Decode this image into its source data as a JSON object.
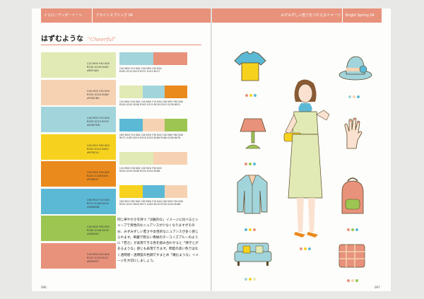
{
  "left_page": {
    "header_category": "イエローアンダートーン",
    "header_section": "ブライトスプリング 04",
    "title_jp": "はずむような",
    "title_en": "\"Cheerful\"",
    "swatches": [
      {
        "color": "#e1eab4",
        "cmyk": "C10 M00 Y40 K00",
        "rgb": "R240 G245 B180",
        "hex": "#EEF4A0"
      },
      {
        "color": "#f6d2b2",
        "cmyk": "C00 M20 Y30 K00",
        "rgb": "R250 G220 B186",
        "hex": "#F9DCBA"
      },
      {
        "color": "#a2d4dc",
        "cmyk": "C40 M00 Y15 K00",
        "rgb": "R163 G215 B219",
        "hex": "#A3D7DB"
      },
      {
        "color": "#f6d21e",
        "cmyk": "C00 M10 Y85 K00",
        "rgb": "R255 G222 B020",
        "hex": "#FFDE14"
      },
      {
        "color": "#ea8a1c",
        "cmyk": "C00 M55 Y90 K00",
        "rgb": "R243 G138 B031",
        "hex": "#F38A1F"
      },
      {
        "color": "#5cb9d5",
        "cmyk": "C65 M00 Y10 K00",
        "rgb": "R072 G185 B219",
        "hex": "#48B9DB"
      },
      {
        "color": "#9cc552",
        "cmyk": "C40 M00 Y80 K00",
        "rgb": "R166 G208 B076",
        "hex": "#A6D04C"
      },
      {
        "color": "#e8927b",
        "cmyk": "C00 M50 Y45 K00",
        "rgb": "R237 G153 B127",
        "hex": "#ED997F"
      }
    ],
    "combos": [
      {
        "cells": [
          {
            "color": "#a2d4dc",
            "w": 0.5
          },
          {
            "color": "#e8927b",
            "w": 0.5
          }
        ],
        "label1": "C40 M00 Y15 K00  C00 M50 Y45 K00",
        "label2": "R163 G215 B219  R237 G153 B127"
      },
      {
        "cells": [
          {
            "color": "#e1eab4",
            "w": 0.34
          },
          {
            "color": "#a2d4dc",
            "w": 0.33
          },
          {
            "color": "#ea8a1c",
            "w": 0.33
          }
        ],
        "label1": "C10 M00 Y40 K00  C40 M00 Y15 K00  C00 M55 Y90 K00",
        "label2": "R240 G245 B180  R163 G215 B219  R243 G138 B031"
      },
      {
        "cells": [
          {
            "color": "#5cb9d5",
            "w": 0.34
          },
          {
            "color": "#f6d2b2",
            "w": 0.33
          },
          {
            "color": "#9cc552",
            "w": 0.33
          }
        ],
        "label1": "C65 M00 Y10 K00  C00 M20 Y30 K00  C40 M00 Y80 K00",
        "label2": "R072 G185 B219  R250 G220 B186  R166 G208 B076"
      },
      {
        "cells": [
          {
            "color": "#e1eab4",
            "w": 0.5
          },
          {
            "color": "#f6d2b2",
            "w": 0.5
          }
        ],
        "label1": "C10 M00 Y40 K00  C00 M20 Y30 K00",
        "label2": "R240 G245 B180  R250 G220 B186"
      },
      {
        "cells": [
          {
            "color": "#f6d21e",
            "w": 0.34
          },
          {
            "color": "#5cb9d5",
            "w": 0.33
          },
          {
            "color": "#f6d2b2",
            "w": 0.33
          }
        ],
        "label1": "C00 M10 Y85 K00  C65 M00 Y10 K00  C00 M20 Y30 K00",
        "label2": "R255 G222 B020  R072 G185 B219  R250 G220 B186"
      }
    ],
    "body_text": "同じ華やかさを持つ「派動的な」イメージに比べるとシャープで男性的なニュアンスが少なくなりますがその分、みずみずしい若さや女性的なニュアンスが多く感じられます。華麗で明るい青緑のターコイズブルーのように「若さ」が表現できる色を組み合わせると「弾きとがあるような」感じも表現できます。明度の高い色ではなく透明感・透明度の色鋼ですまとめ「躍むような」イメージを大切にしましょう。",
    "page_number": "096"
  },
  "right_page": {
    "header_section": "みずみずしい若さをつたえるイメージ",
    "header_en": "Bright Spring 04",
    "page_number": "097"
  },
  "illustrations": [
    {
      "name": "tshirt-icon"
    },
    {
      "name": "hat-icon"
    },
    {
      "name": "lamp-icon"
    },
    {
      "name": "hand-icon"
    },
    {
      "name": "jacket-icon"
    },
    {
      "name": "backpack-icon"
    },
    {
      "name": "woman-figure"
    },
    {
      "name": "sofa-icon"
    },
    {
      "name": "cushion-icon"
    }
  ]
}
